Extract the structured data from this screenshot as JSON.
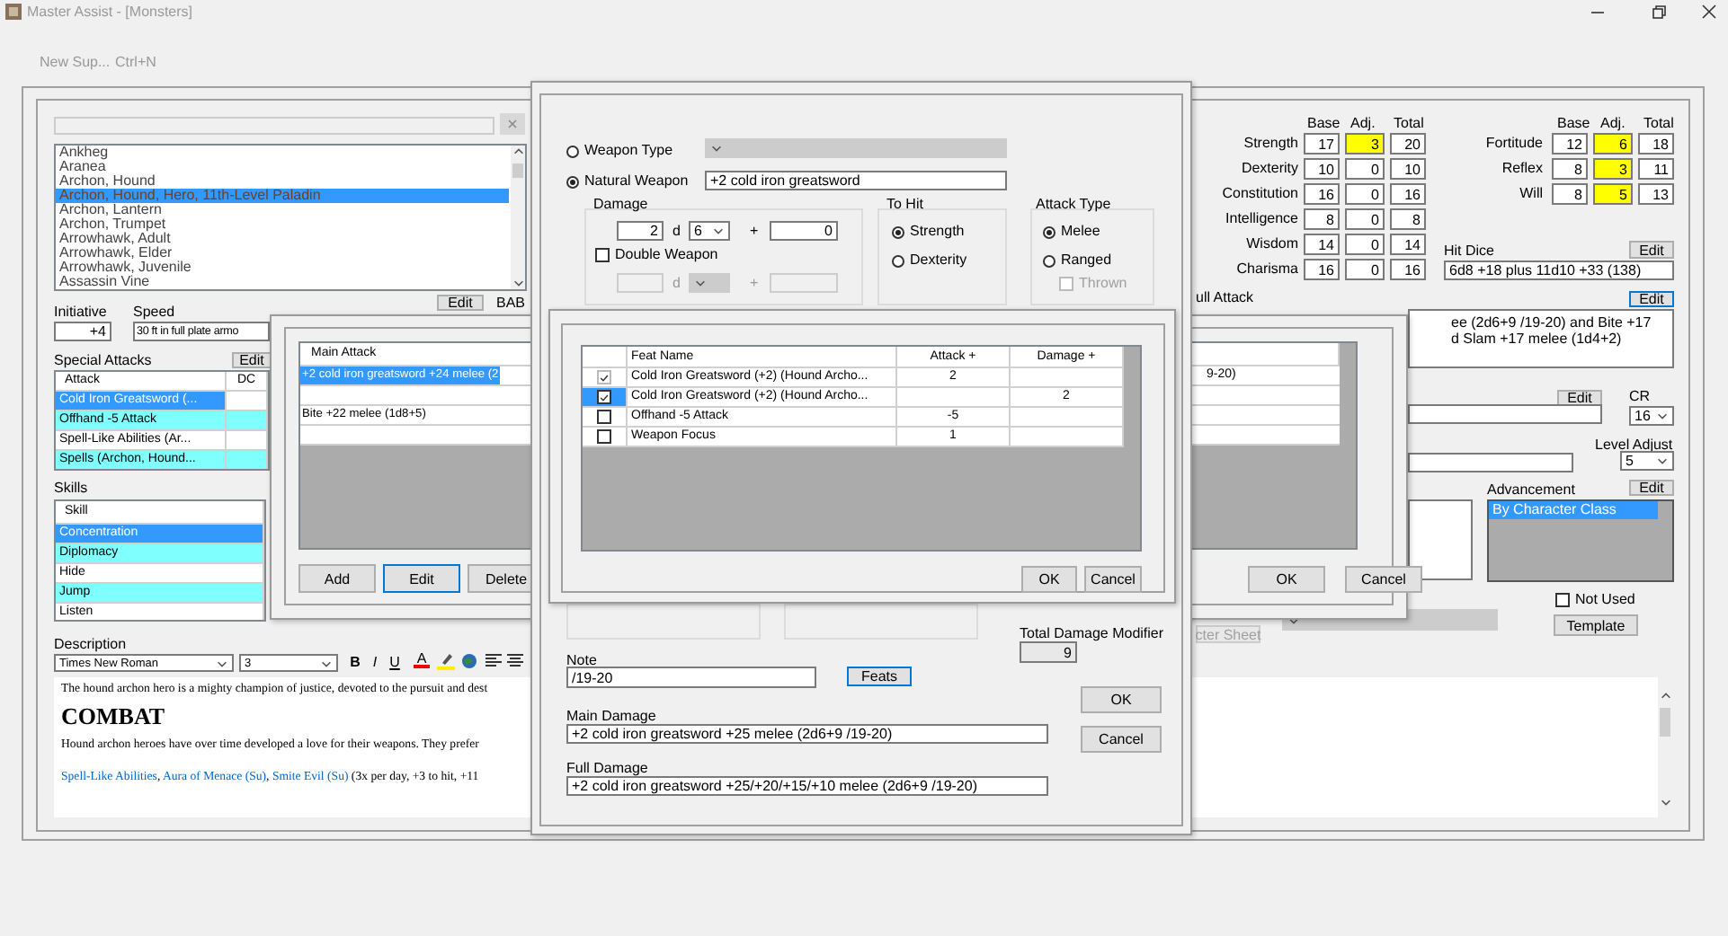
{
  "window": {
    "title": "Master Assist - [Monsters]"
  },
  "menu_hint": {
    "label": "New Sup...",
    "shortcut": "Ctrl+N"
  },
  "monsters": {
    "items": [
      {
        "name": "Ankheg",
        "selected": false
      },
      {
        "name": "Aranea",
        "selected": false
      },
      {
        "name": "Archon, Hound",
        "selected": false
      },
      {
        "name": "Archon, Hound, Hero, 11th-Level Paladin",
        "selected": true
      },
      {
        "name": "Archon, Lantern",
        "selected": false
      },
      {
        "name": "Archon, Trumpet",
        "selected": false
      },
      {
        "name": "Arrowhawk, Adult",
        "selected": false
      },
      {
        "name": "Arrowhawk, Elder",
        "selected": false
      },
      {
        "name": "Arrowhawk, Juvenile",
        "selected": false
      },
      {
        "name": "Assassin Vine",
        "selected": false
      }
    ]
  },
  "initiative": {
    "label": "Initiative",
    "value": "+4"
  },
  "speed": {
    "label": "Speed",
    "value": "30 ft in full plate armo",
    "button": "Edit"
  },
  "bab": {
    "label": "BAB"
  },
  "special_attacks": {
    "label": "Special Attacks",
    "button": "Edit",
    "columns": [
      "Attack",
      "DC"
    ],
    "rows": [
      {
        "attack": "Cold Iron Greatsword (...",
        "selected": true,
        "color": "#3399ff"
      },
      {
        "attack": "Offhand -5 Attack",
        "selected": false,
        "color": "#80ffff"
      },
      {
        "attack": "Spell-Like Abilities (Ar...",
        "selected": false,
        "color": "#ffffff"
      },
      {
        "attack": "Spells (Archon, Hound...",
        "selected": false,
        "color": "#80ffff"
      }
    ]
  },
  "skills": {
    "label": "Skills",
    "columns": [
      "Skill"
    ],
    "rows": [
      {
        "skill": "Concentration",
        "selected": true,
        "color": "#3399ff"
      },
      {
        "skill": "Diplomacy",
        "selected": false,
        "color": "#80ffff"
      },
      {
        "skill": "Hide",
        "selected": false,
        "color": "#ffffff"
      },
      {
        "skill": "Jump",
        "selected": false,
        "color": "#80ffff"
      },
      {
        "skill": "Listen",
        "selected": false,
        "color": "#ffffff"
      }
    ]
  },
  "description": {
    "label": "Description",
    "font": "Times New Roman",
    "size": "3",
    "format_buttons": [
      "B",
      "I",
      "U"
    ],
    "color_button": "A",
    "paragraphs": [
      {
        "kind": "text",
        "text": "The hound archon hero is a mighty champion of justice, devoted to the pursuit and dest"
      },
      {
        "kind": "heading",
        "text": "COMBAT"
      },
      {
        "kind": "text",
        "text": "Hound archon heroes have over time developed a love for their weapons. They prefer"
      },
      {
        "kind": "links",
        "parts": [
          {
            "kind": "link",
            "text": "Spell-Like Abilities"
          },
          {
            "kind": "text",
            "text": ", "
          },
          {
            "kind": "link",
            "text": "Aura of Menace (Su)"
          },
          {
            "kind": "text",
            "text": ", "
          },
          {
            "kind": "link",
            "text": "Smite Evil (Su)"
          },
          {
            "kind": "text",
            "text": " (3x per day, +3 to hit, +11"
          }
        ]
      }
    ]
  },
  "abilities": {
    "columns": [
      "Base",
      "Adj.",
      "Total"
    ],
    "rows": [
      {
        "name": "Strength",
        "base": "17",
        "adj": "3",
        "total": "20",
        "modified": true
      },
      {
        "name": "Dexterity",
        "base": "10",
        "adj": "0",
        "total": "10",
        "modified": false
      },
      {
        "name": "Constitution",
        "base": "16",
        "adj": "0",
        "total": "16",
        "modified": false
      },
      {
        "name": "Intelligence",
        "base": "8",
        "adj": "0",
        "total": "8",
        "modified": false
      },
      {
        "name": "Wisdom",
        "base": "14",
        "adj": "0",
        "total": "14",
        "modified": false
      },
      {
        "name": "Charisma",
        "base": "16",
        "adj": "0",
        "total": "16",
        "modified": false
      }
    ]
  },
  "saves": {
    "columns": [
      "Base",
      "Adj.",
      "Total"
    ],
    "rows": [
      {
        "name": "Fortitude",
        "base": "12",
        "adj": "6",
        "total": "18",
        "modified": true
      },
      {
        "name": "Reflex",
        "base": "8",
        "adj": "3",
        "total": "11",
        "modified": true
      },
      {
        "name": "Will",
        "base": "8",
        "adj": "5",
        "total": "13",
        "modified": true
      }
    ]
  },
  "hit_dice": {
    "label": "Hit Dice",
    "button": "Edit",
    "value": "6d8 +18 plus 11d10 +33 (138)"
  },
  "full_attack": {
    "label": "ull Attack",
    "button": "Edit",
    "lines": [
      "ee (2d6+9 /19-20) and Bite +17",
      "d Slam +17 melee (1d4+2)"
    ]
  },
  "cr": {
    "button": "Edit",
    "label": "CR",
    "value": "16"
  },
  "level_adjust": {
    "label": "Level Adjust",
    "value": "5"
  },
  "advancement": {
    "label": "Advancement",
    "button": "Edit",
    "items": [
      {
        "name": "By Character Class",
        "selected": true
      }
    ]
  },
  "not_used": {
    "label": "Not Used",
    "checked": false
  },
  "template_button": "Template",
  "sheet_button": {
    "label": "cter Sheet",
    "disabled": true
  },
  "attack_dialog": {
    "column": "Main Attack",
    "rows": [
      {
        "text": "+2 cold iron greatsword +24 melee (2",
        "tail": "9-20)",
        "selected": true
      },
      {
        "selected": false
      },
      {
        "text": "Bite +22 melee (1d8+5)",
        "selected": false
      },
      {
        "selected": false
      }
    ],
    "buttons": [
      {
        "label": "Add",
        "default": false
      },
      {
        "label": "Edit",
        "default": true
      },
      {
        "label": "Delete",
        "default": false
      }
    ],
    "ok": "OK",
    "cancel": "Cancel"
  },
  "weapon_dialog": {
    "weapon_type": {
      "label": "Weapon Type",
      "selected": false
    },
    "natural_weapon": {
      "label": "Natural Weapon",
      "selected": true,
      "value": "+2 cold iron greatsword"
    },
    "damage": {
      "label": "Damage",
      "count": "2",
      "d": "d",
      "die": "6",
      "plus": "+",
      "bonus": "0",
      "double_weapon": {
        "label": "Double Weapon",
        "checked": false
      },
      "second_d": "d",
      "second_plus": "+"
    },
    "to_hit": {
      "label": "To Hit",
      "options": [
        {
          "label": "Strength",
          "selected": true
        },
        {
          "label": "Dexterity",
          "selected": false
        }
      ]
    },
    "attack_type": {
      "label": "Attack Type",
      "options": [
        {
          "label": "Melee",
          "selected": true
        },
        {
          "label": "Ranged",
          "selected": false
        }
      ],
      "thrown": {
        "label": "Thrown",
        "checked": false,
        "disabled": true
      }
    },
    "feats": {
      "columns": [
        "Feat Name",
        "Attack +",
        "Damage +"
      ],
      "rows": [
        {
          "name": "Cold Iron Greatsword (+2) (Hound Archo...",
          "attack": "2",
          "checked": true,
          "disabled": true,
          "selected": false
        },
        {
          "name": "Cold Iron Greatsword (+2) (Hound Archo...",
          "damage": "2",
          "checked": true,
          "disabled": false,
          "selected": true
        },
        {
          "name": "Offhand -5 Attack",
          "attack": "-5",
          "checked": false,
          "disabled": false,
          "selected": false
        },
        {
          "name": "Weapon Focus",
          "attack": "1",
          "checked": false,
          "disabled": false,
          "selected": false
        }
      ],
      "ok": "OK",
      "cancel": "Cancel"
    },
    "total_damage_modifier": {
      "label": "Total Damage Modifier",
      "value": "9"
    },
    "note": {
      "label": "Note",
      "value": "/19-20"
    },
    "feats_button": "Feats",
    "ok": "OK",
    "cancel": "Cancel",
    "main_damage": {
      "label": "Main Damage",
      "value": "+2 cold iron greatsword +25 melee (2d6+9 /19-20)"
    },
    "full_damage": {
      "label": "Full Damage",
      "value": "+2 cold iron greatsword +25/+20/+15/+10 melee (2d6+9 /19-20)"
    }
  }
}
